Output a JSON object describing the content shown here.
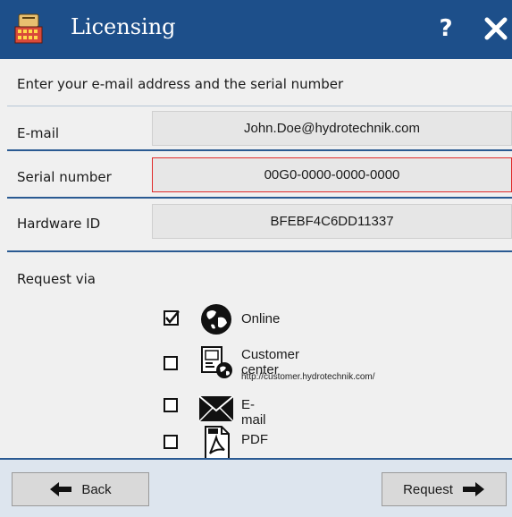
{
  "window": {
    "title": "Licensing"
  },
  "header": {
    "help_label": "?"
  },
  "intro_text": "Enter your e-mail address and the serial number",
  "form": {
    "email": {
      "label": "E-mail",
      "value": "John.Doe@hydrotechnik.com"
    },
    "serial": {
      "label": "Serial number",
      "value": "00G0-0000-0000-0000",
      "status": "error"
    },
    "hardware": {
      "label": "Hardware ID",
      "value": "BFEBF4C6DD11337"
    }
  },
  "request_via": {
    "label": "Request via",
    "options": [
      {
        "label": "Online",
        "checked": true,
        "icon": "globe-icon"
      },
      {
        "label": "Customer center",
        "sublabel": "http://customer.hydrotechnik.com/",
        "checked": false,
        "icon": "customer-center-icon"
      },
      {
        "label": "E-mail",
        "checked": false,
        "icon": "envelope-icon"
      },
      {
        "label": "PDF",
        "checked": false,
        "icon": "pdf-icon"
      }
    ]
  },
  "buttons": {
    "back": "Back",
    "request": "Request"
  },
  "colors": {
    "titlebar": "#1d4f8a",
    "error_border": "#e02a2a",
    "footer_bg": "#dde5ee",
    "separator": "#2a5a92"
  }
}
